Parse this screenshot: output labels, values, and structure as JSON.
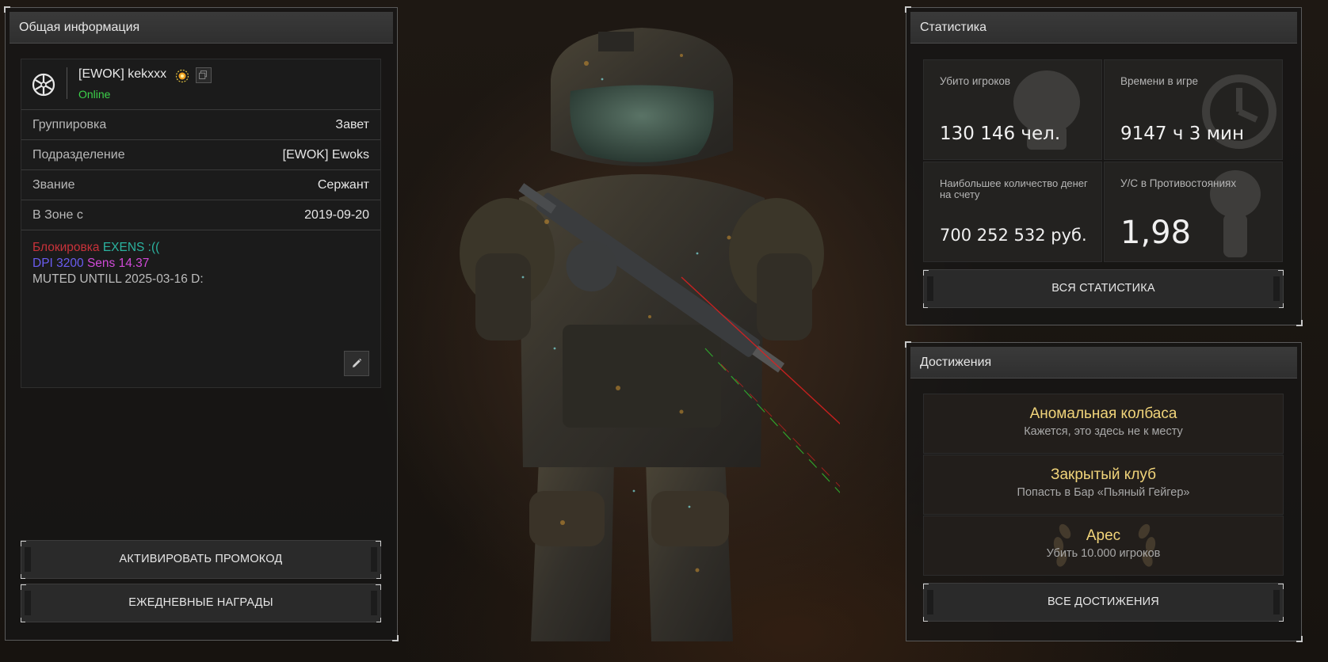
{
  "info_panel": {
    "title": "Общая информация",
    "player_name": "[EWOK] kekxxx",
    "status": "Online",
    "rows": [
      {
        "label": "Группировка",
        "value": "Завет"
      },
      {
        "label": "Подразделение",
        "value": "[EWOK] Ewoks"
      },
      {
        "label": "Звание",
        "value": "Сержант"
      },
      {
        "label": "В Зоне с",
        "value": "2019-09-20"
      }
    ],
    "bio": {
      "line1_part1": "Блокировка",
      "line1_part2": "EXENS :((",
      "line2_part1": "DPI 3200",
      "line2_part2": "Sens 14.37",
      "line3": "MUTED UNTILL 2025-03-16 D:"
    },
    "buttons": {
      "promo": "АКТИВИРОВАТЬ ПРОМОКОД",
      "daily": "ЕЖЕДНЕВНЫЕ НАГРАДЫ"
    }
  },
  "stats_panel": {
    "title": "Статистика",
    "cells": [
      {
        "label": "Убито игроков",
        "value": "130 146 чел."
      },
      {
        "label": "Времени в игре",
        "value": "9147 ч 3 мин"
      },
      {
        "label": "Наибольшее количество денег на счету",
        "value": "700 252 532 руб."
      },
      {
        "label": "У/С в Противостояниях",
        "value": "1,98"
      }
    ],
    "button": "ВСЯ СТАТИСТИКА"
  },
  "achievements_panel": {
    "title": "Достижения",
    "items": [
      {
        "title": "Аномальная колбаса",
        "desc": "Кажется, это здесь не к месту"
      },
      {
        "title": "Закрытый клуб",
        "desc": "Попасть в Бар «Пьяный Гейгер»"
      },
      {
        "title": "Арес",
        "desc": "Убить 10.000 игроков"
      }
    ],
    "button": "ВСЕ ДОСТИЖЕНИЯ"
  },
  "colors": {
    "online": "#3cd14a",
    "achievement_title": "#f1d47a",
    "bio_red": "#c8323a",
    "bio_cyan": "#2bb3a0",
    "bio_blue": "#6a5cf0",
    "bio_magenta": "#d04ad8"
  },
  "icons": [
    "clan-emblem-icon",
    "sun-badge-icon",
    "copy-icon",
    "pencil-icon",
    "skull-icon",
    "clock-icon",
    "laurel-icon"
  ]
}
